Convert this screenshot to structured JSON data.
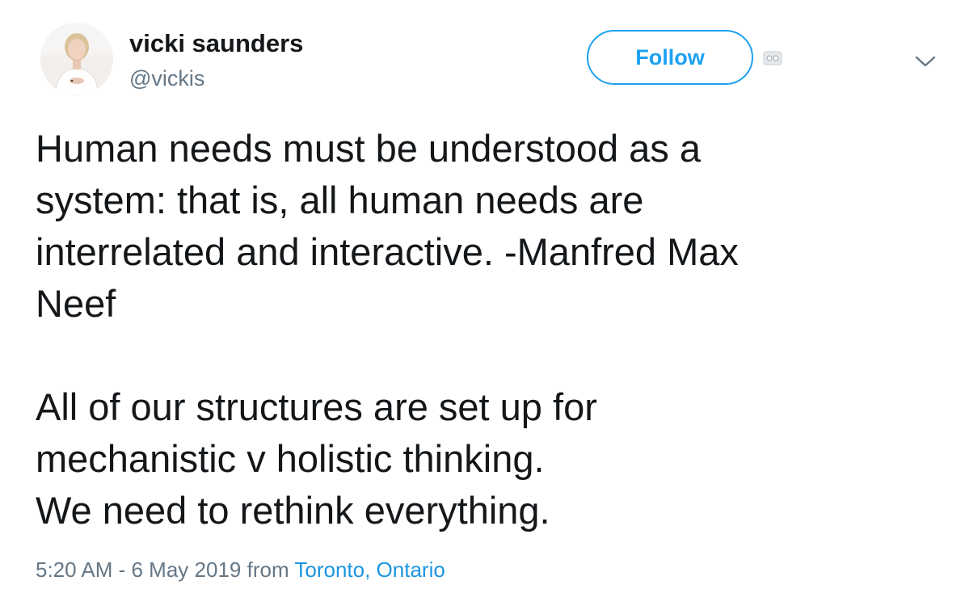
{
  "author": {
    "display_name": "vicki saunders",
    "handle": "@vickis",
    "avatar_icon": "profile-photo-icon"
  },
  "header": {
    "follow_label": "Follow",
    "follow_color": "#1da1f2",
    "extension_icon": "browser-extension-icon",
    "menu_icon": "chevron-down-icon"
  },
  "tweet": {
    "lines": [
      "Human needs must be understood as a",
      "system: that is, all human needs are",
      "interrelated and interactive. -Manfred Max",
      "Neef",
      "",
      "All of our structures are set up for",
      "mechanistic v holistic thinking.",
      "We need to rethink everything."
    ]
  },
  "meta": {
    "timestamp": "5:20 AM - 6 May 2019",
    "from_label": "from",
    "location": "Toronto, Ontario",
    "location_color": "#1b95e0"
  }
}
